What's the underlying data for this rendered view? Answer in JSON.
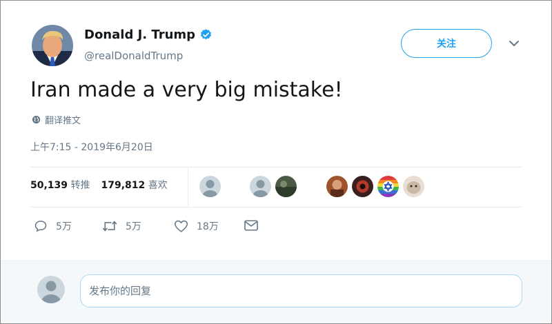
{
  "user": {
    "name": "Donald J. Trump",
    "handle": "@realDonaldTrump"
  },
  "follow_label": "关注",
  "tweet": {
    "text": "Iran made a very big mistake!",
    "translate_label": "翻译推文",
    "timestamp": "上午7:15 - 2019年6月20日"
  },
  "stats": {
    "retweets_count": "50,139",
    "retweets_label": "转推",
    "likes_count": "179,812",
    "likes_label": "喜欢"
  },
  "actions": {
    "reply_count": "5万",
    "retweet_count": "5万",
    "like_count": "18万"
  },
  "reply": {
    "placeholder": "发布你的回复"
  },
  "colors": {
    "accent": "#1da1f2",
    "secondary_text": "#657786",
    "primary_text": "#14171a"
  }
}
